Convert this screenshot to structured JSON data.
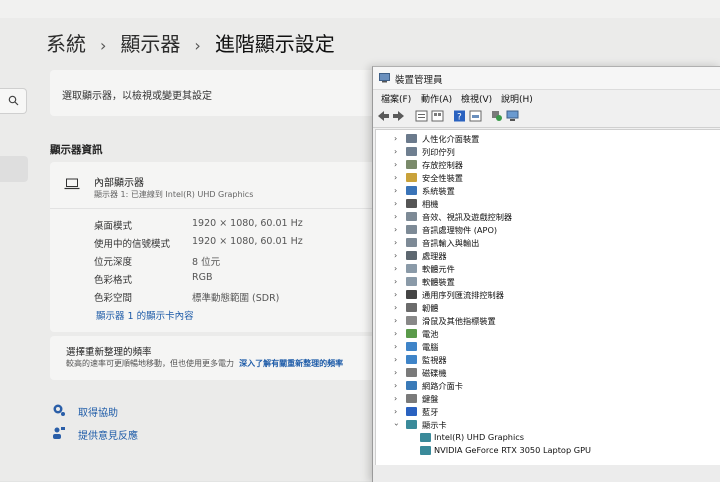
{
  "settings": {
    "breadcrumb": [
      "系統",
      "顯示器",
      "進階顯示設定"
    ],
    "breadcrumb_sep": "›",
    "select_display_label": "選取顯示器，以檢視或變更其設定",
    "section_title": "顯示器資訊",
    "display": {
      "name": "內部顯示器",
      "subtitle": "顯示器 1: 已連線到 Intel(R) UHD Graphics",
      "rows": [
        {
          "label": "桌面模式",
          "value": "1920 × 1080, 60.01 Hz"
        },
        {
          "label": "使用中的信號模式",
          "value": "1920 × 1080, 60.01 Hz"
        },
        {
          "label": "位元深度",
          "value": "8 位元"
        },
        {
          "label": "色彩格式",
          "value": "RGB"
        },
        {
          "label": "色彩空間",
          "value": "標準動態範圍 (SDR)"
        }
      ],
      "adapter_link": "顯示器 1 的顯示卡內容"
    },
    "refresh": {
      "title": "選擇重新整理的頻率",
      "desc": "較高的速率可更順暢地移動，但也使用更多電力",
      "link": "深入了解有關重新整理的頻率"
    },
    "help": [
      {
        "label": "取得協助",
        "icon": "help-icon"
      },
      {
        "label": "提供意見反應",
        "icon": "feedback-icon"
      }
    ]
  },
  "device_manager": {
    "title": "裝置管理員",
    "menu": [
      "檔案(F)",
      "動作(A)",
      "檢視(V)",
      "說明(H)"
    ],
    "categories": [
      {
        "label": "人性化介面裝置",
        "icon": "hid-icon",
        "color": "#6b7a8c"
      },
      {
        "label": "列印佇列",
        "icon": "printer-icon",
        "color": "#6f7f90"
      },
      {
        "label": "存放控制器",
        "icon": "storage-controller-icon",
        "color": "#7a8a6a"
      },
      {
        "label": "安全性裝置",
        "icon": "security-icon",
        "color": "#c9a23a"
      },
      {
        "label": "系統裝置",
        "icon": "system-folder-icon",
        "color": "#3a74b8"
      },
      {
        "label": "相機",
        "icon": "camera-icon",
        "color": "#555555"
      },
      {
        "label": "音效、視訊及遊戲控制器",
        "icon": "sound-icon",
        "color": "#7d8a96"
      },
      {
        "label": "音訊處理物件 (APO)",
        "icon": "audio-apo-icon",
        "color": "#7d8a96"
      },
      {
        "label": "音訊輸入與輸出",
        "icon": "audio-io-icon",
        "color": "#7d8a96"
      },
      {
        "label": "處理器",
        "icon": "processor-icon",
        "color": "#5d6770"
      },
      {
        "label": "軟體元件",
        "icon": "software-component-icon",
        "color": "#8a9aa8"
      },
      {
        "label": "軟體裝置",
        "icon": "software-device-icon",
        "color": "#8a9aa8"
      },
      {
        "label": "通用序列匯流排控制器",
        "icon": "usb-icon",
        "color": "#444444"
      },
      {
        "label": "韌體",
        "icon": "firmware-icon",
        "color": "#6b6b6b"
      },
      {
        "label": "滑鼠及其他指標裝置",
        "icon": "mouse-icon",
        "color": "#888888"
      },
      {
        "label": "電池",
        "icon": "battery-icon",
        "color": "#5a9a4a"
      },
      {
        "label": "電腦",
        "icon": "computer-icon",
        "color": "#3f84c8"
      },
      {
        "label": "監視器",
        "icon": "monitor-icon",
        "color": "#3f84c8"
      },
      {
        "label": "磁碟機",
        "icon": "disk-drive-icon",
        "color": "#7a7a7a"
      },
      {
        "label": "網路介面卡",
        "icon": "network-adapter-icon",
        "color": "#3a7ab8"
      },
      {
        "label": "鍵盤",
        "icon": "keyboard-icon",
        "color": "#7a7a7a"
      },
      {
        "label": "藍牙",
        "icon": "bluetooth-icon",
        "color": "#2a62c0"
      },
      {
        "label": "顯示卡",
        "icon": "display-adapter-icon",
        "color": "#3a8a9a",
        "expanded": true
      }
    ],
    "display_adapters": [
      "Intel(R) UHD Graphics",
      "NVIDIA GeForce RTX 3050 Laptop GPU"
    ]
  }
}
